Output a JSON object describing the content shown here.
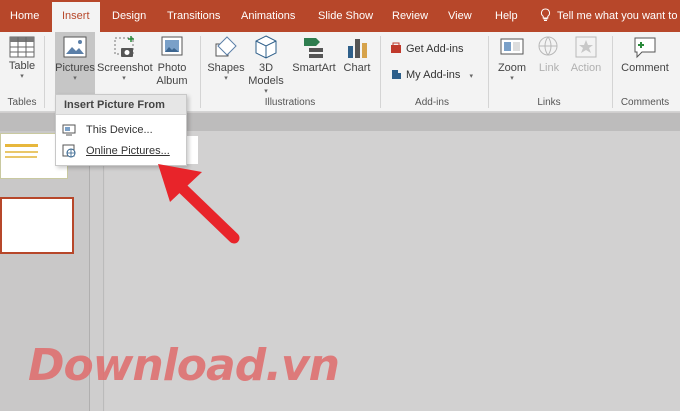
{
  "tabs": [
    {
      "label": "Home"
    },
    {
      "label": "Insert"
    },
    {
      "label": "Design"
    },
    {
      "label": "Transitions"
    },
    {
      "label": "Animations"
    },
    {
      "label": "Slide Show"
    },
    {
      "label": "Review"
    },
    {
      "label": "View"
    },
    {
      "label": "Help"
    }
  ],
  "tell_me": "Tell me what you want to",
  "ribbon": {
    "table": "Table",
    "pictures": "Pictures",
    "screenshot": "Screenshot",
    "photo_album_1": "Photo",
    "photo_album_2": "Album",
    "shapes": "Shapes",
    "models_1": "3D",
    "models_2": "Models",
    "smartart": "SmartArt",
    "chart": "Chart",
    "get_addins": "Get Add-ins",
    "my_addins": "My Add-ins",
    "zoom": "Zoom",
    "link": "Link",
    "action": "Action",
    "comment": "Comment",
    "groups": {
      "tables": "Tables",
      "illustrations": "Illustrations",
      "addins": "Add-ins",
      "links": "Links",
      "comments": "Comments"
    }
  },
  "dropdown": {
    "header": "Insert Picture From",
    "this_device": "This Device...",
    "online_pictures": "Online Pictures..."
  },
  "watermark": "Download.vn",
  "colors": {
    "accent": "#b7472a",
    "arrow": "#e8242a"
  }
}
